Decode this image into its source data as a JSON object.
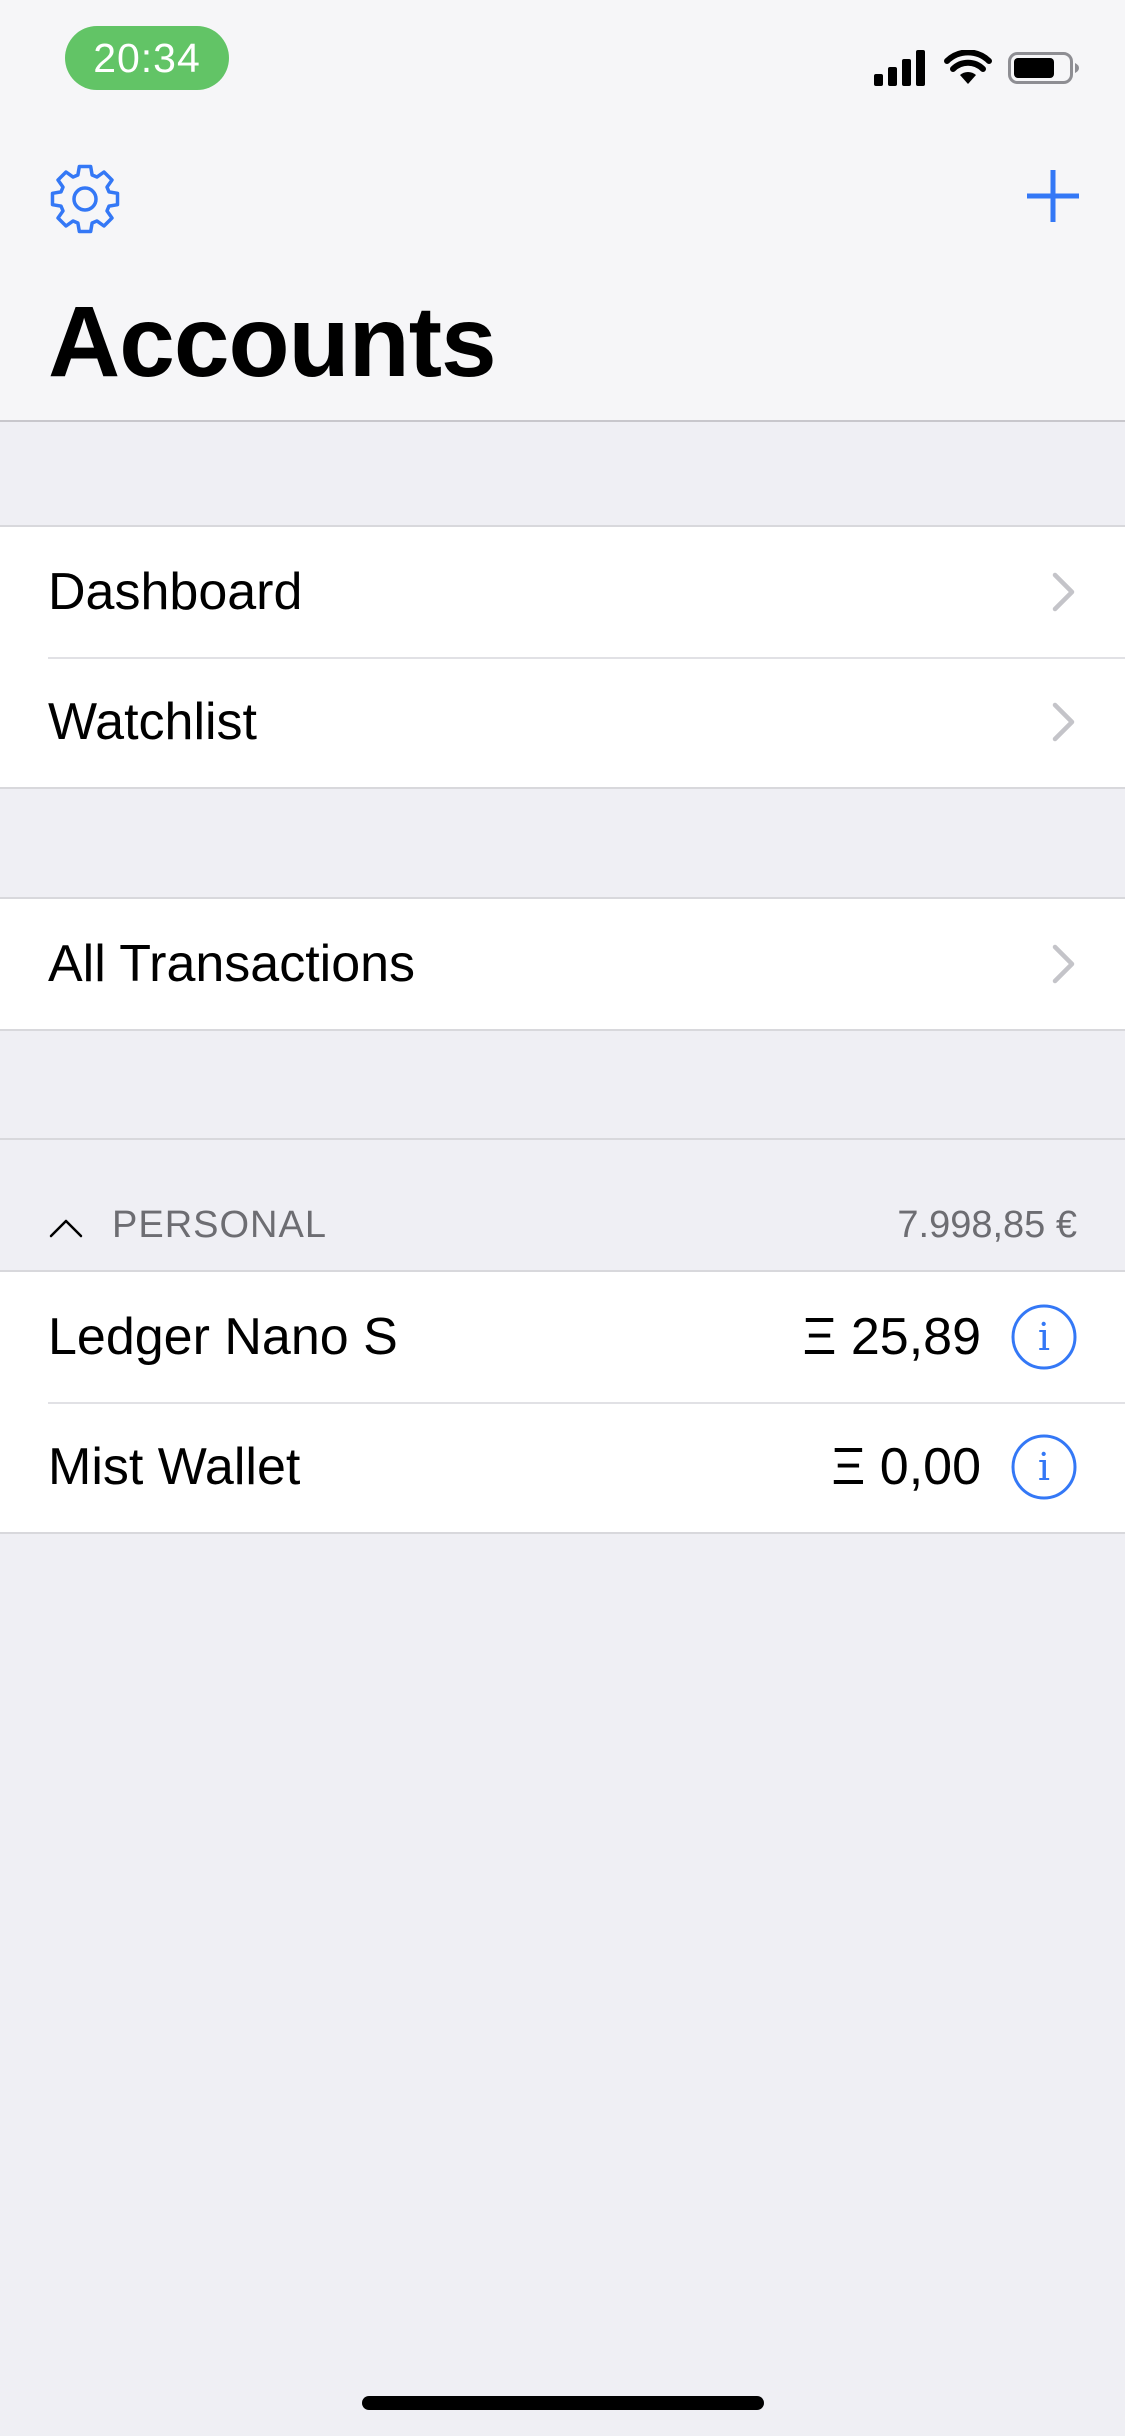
{
  "status_bar": {
    "time": "20:34"
  },
  "nav": {
    "title": "Accounts",
    "settings_icon": "gear-icon",
    "add_icon": "plus-icon"
  },
  "colors": {
    "accent": "#3478f6",
    "time_pill": "#62c466",
    "background": "#efeff4"
  },
  "menu_group_1": [
    {
      "label": "Dashboard"
    },
    {
      "label": "Watchlist"
    }
  ],
  "menu_group_2": [
    {
      "label": "All Transactions"
    }
  ],
  "personal_section": {
    "title": "PERSONAL",
    "total": "7.998,85 €",
    "accounts": [
      {
        "name": "Ledger Nano S",
        "balance": "Ξ 25,89"
      },
      {
        "name": "Mist Wallet",
        "balance": "Ξ 0,00"
      }
    ]
  }
}
